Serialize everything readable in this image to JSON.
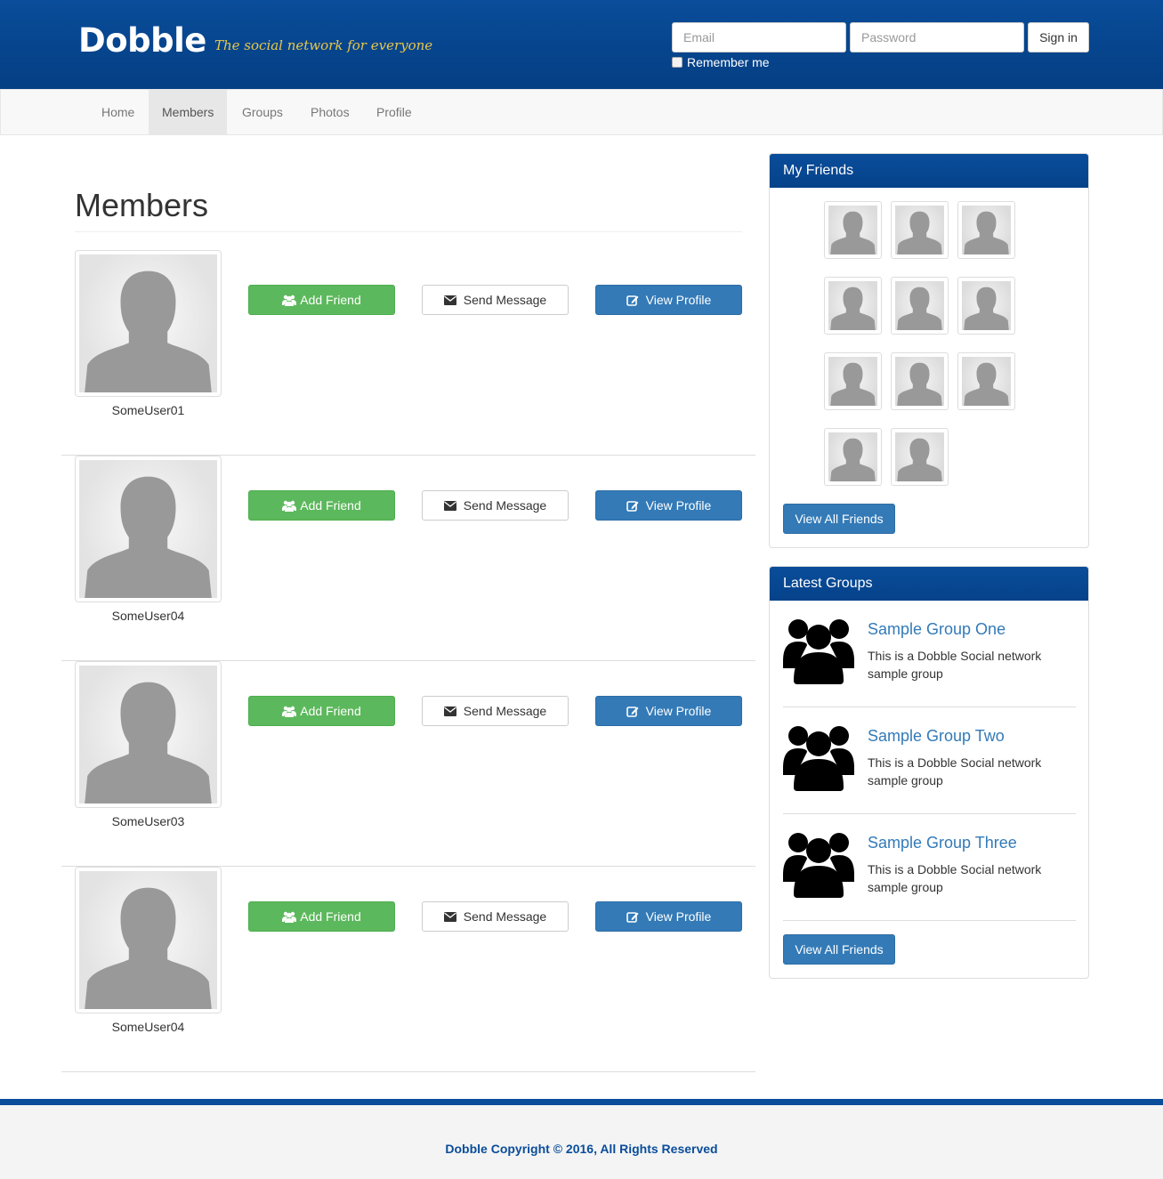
{
  "header": {
    "logo": "Dobble",
    "tagline": "The social network for everyone",
    "email_placeholder": "Email",
    "password_placeholder": "Password",
    "signin_label": "Sign in",
    "remember_label": "Remember me"
  },
  "nav": {
    "items": [
      {
        "label": "Home"
      },
      {
        "label": "Members",
        "active": true
      },
      {
        "label": "Groups"
      },
      {
        "label": "Photos"
      },
      {
        "label": "Profile"
      }
    ]
  },
  "main": {
    "title": "Members",
    "add_friend_label": "Add Friend",
    "send_message_label": "Send Message",
    "view_profile_label": "View Profile",
    "members": [
      {
        "username": "SomeUser01"
      },
      {
        "username": "SomeUser04"
      },
      {
        "username": "SomeUser03"
      },
      {
        "username": "SomeUser04"
      }
    ]
  },
  "friends_panel": {
    "title": "My Friends",
    "friend_count": 11,
    "button_label": "View All Friends"
  },
  "groups_panel": {
    "title": "Latest Groups",
    "groups": [
      {
        "title": "Sample Group One",
        "description": "This is a Dobble Social network sample group"
      },
      {
        "title": "Sample Group Two",
        "description": "This is a Dobble Social network sample group"
      },
      {
        "title": "Sample Group Three",
        "description": "This is a Dobble Social network sample group"
      }
    ],
    "button_label": "View All Friends"
  },
  "footer": {
    "text": "Dobble Copyright © 2016, All Rights Reserved"
  },
  "colors": {
    "brand_blue": "#0a4d9a",
    "success_green": "#5cb85c",
    "primary_blue": "#337ab7",
    "tagline_gold": "#e8c64a"
  }
}
